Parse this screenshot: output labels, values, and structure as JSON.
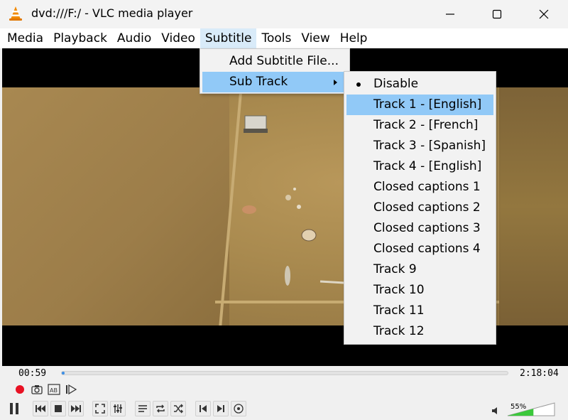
{
  "window": {
    "title": "dvd:///F:/ - VLC media player"
  },
  "menubar": {
    "items": [
      "Media",
      "Playback",
      "Audio",
      "Video",
      "Subtitle",
      "Tools",
      "View",
      "Help"
    ],
    "open_item": "Subtitle"
  },
  "subtitle_menu": {
    "items": [
      {
        "label": "Add Subtitle File...",
        "has_submenu": false
      },
      {
        "label": "Sub Track",
        "has_submenu": true,
        "highlighted": true
      }
    ]
  },
  "sub_track_menu": {
    "items": [
      {
        "label": "Disable",
        "selected": true
      },
      {
        "label": "Track 1 - [English]",
        "highlighted": true
      },
      {
        "label": "Track 2 - [French]"
      },
      {
        "label": "Track 3 - [Spanish]"
      },
      {
        "label": "Track 4 - [English]"
      },
      {
        "label": "Closed captions 1"
      },
      {
        "label": "Closed captions 2"
      },
      {
        "label": "Closed captions 3"
      },
      {
        "label": "Closed captions 4"
      },
      {
        "label": "Track 9"
      },
      {
        "label": "Track 10"
      },
      {
        "label": "Track 11"
      },
      {
        "label": "Track 12"
      }
    ]
  },
  "playback": {
    "elapsed": "00:59",
    "total": "2:18:04",
    "progress": 0.007
  },
  "volume": {
    "label": "55%",
    "level": 0.55
  },
  "colors": {
    "highlight": "#91c9f7",
    "accent": "#3a8ee6",
    "record": "#e81123",
    "volume_fill": "#3cc83c"
  },
  "icons": {
    "app": "vlc-cone-icon",
    "minimize": "minimize-icon",
    "maximize": "maximize-icon",
    "close": "close-icon"
  }
}
